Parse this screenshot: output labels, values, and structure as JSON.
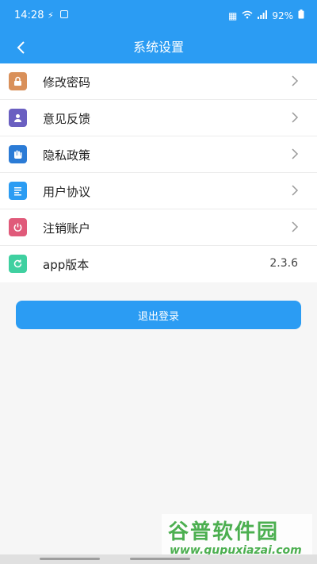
{
  "status_bar": {
    "time": "14:28",
    "left_icons": [
      "bolt-icon",
      "square-icon"
    ],
    "right_icons": [
      "qr-icon",
      "wifi-icon",
      "signal-icon"
    ],
    "battery": "92%"
  },
  "header": {
    "title": "系统设置",
    "back_icon": "chevron-left-icon"
  },
  "settings": {
    "items": [
      {
        "label": "修改密码",
        "icon": "lock-icon",
        "color": "#d9905a",
        "trailing": "chevron"
      },
      {
        "label": "意见反馈",
        "icon": "person-icon",
        "color": "#6a5fc1",
        "trailing": "chevron"
      },
      {
        "label": "隐私政策",
        "icon": "hand-icon",
        "color": "#2b7bd6",
        "trailing": "chevron"
      },
      {
        "label": "用户协议",
        "icon": "document-icon",
        "color": "#2b9cf3",
        "trailing": "chevron"
      },
      {
        "label": "注销账户",
        "icon": "power-icon",
        "color": "#e05a7a",
        "trailing": "chevron"
      },
      {
        "label": "app版本",
        "icon": "refresh-icon",
        "color": "#3fd0a0",
        "trailing": "value",
        "value": "2.3.6"
      }
    ]
  },
  "actions": {
    "logout_label": "退出登录"
  },
  "watermark": {
    "title": "谷普软件园",
    "url": "www.gupuxiazai.com"
  },
  "colors": {
    "primary": "#2b9cf3",
    "background": "#f6f6f6"
  }
}
